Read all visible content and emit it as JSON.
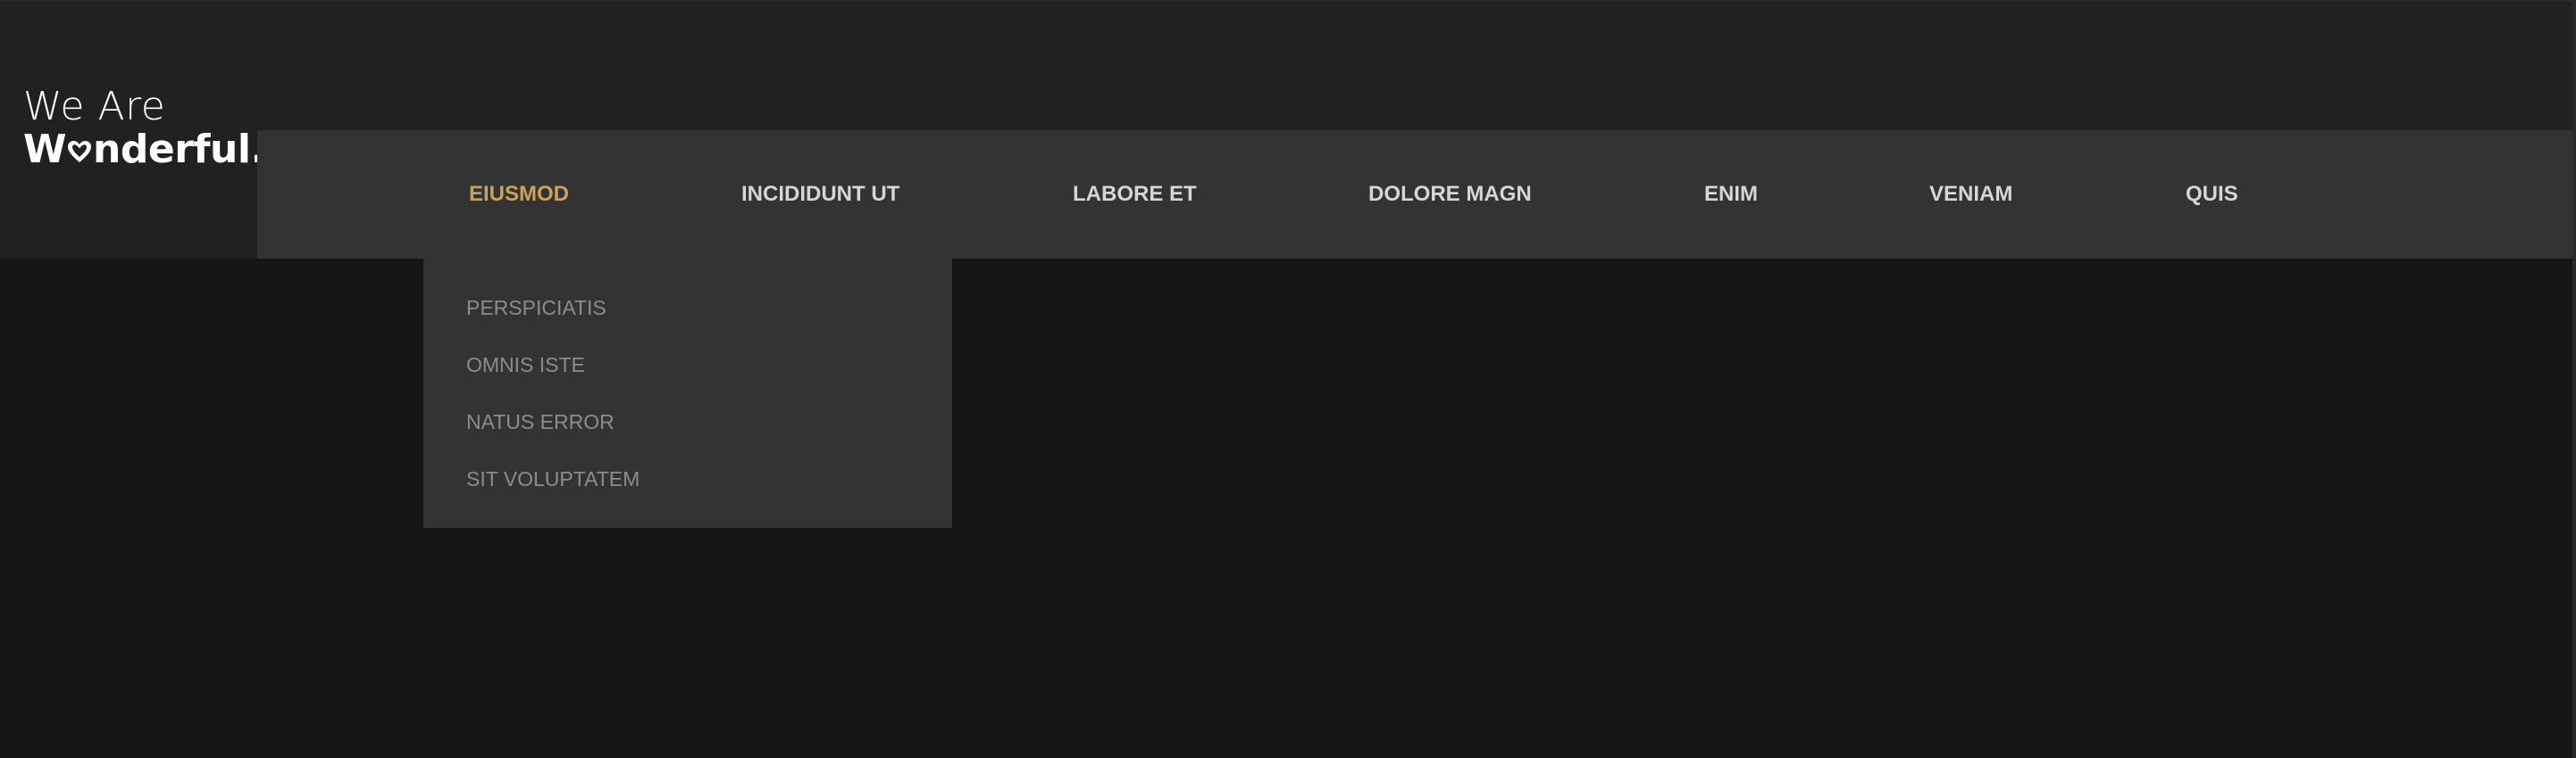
{
  "logo": {
    "line1": "We Are",
    "line2_prefix": "W",
    "line2_suffix": "nderful."
  },
  "nav": {
    "items": [
      {
        "label": "EIUSMOD",
        "active": true
      },
      {
        "label": "INCIDIDUNT UT",
        "active": false
      },
      {
        "label": "LABORE ET",
        "active": false
      },
      {
        "label": "DOLORE MAGN",
        "active": false
      },
      {
        "label": "ENIM",
        "active": false
      },
      {
        "label": "VENIAM",
        "active": false
      },
      {
        "label": "QUIS",
        "active": false
      }
    ]
  },
  "dropdown": {
    "items": [
      {
        "label": "PERSPICIATIS"
      },
      {
        "label": "OMNIS ISTE"
      },
      {
        "label": "NATUS ERROR"
      },
      {
        "label": "SIT VOLUPTATEM"
      }
    ]
  },
  "colors": {
    "background": "#161616",
    "header": "#212121",
    "nav": "#333333",
    "accent": "#c9a35a",
    "nav_text": "#d6d6d6",
    "dropdown_text": "#8c8c8c"
  },
  "icons": {
    "logo_heart": "heart-icon"
  }
}
